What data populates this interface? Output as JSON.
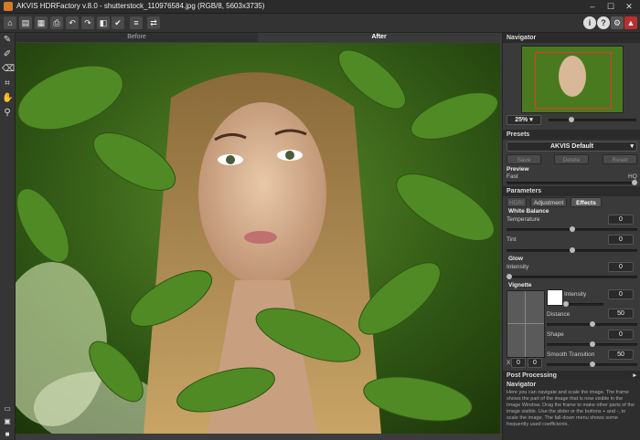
{
  "window": {
    "title": "AKVIS HDRFactory v.8.0 - shutterstock_110976584.jpg (RGB/8, 5603x3735)",
    "minimize": "–",
    "maximize": "☐",
    "close": "✕"
  },
  "toolbar": {
    "help_icon": "?",
    "info_icon": "i"
  },
  "tabs": {
    "before": "Before",
    "after": "After"
  },
  "navigator": {
    "header": "Navigator",
    "zoom": "25%"
  },
  "presets": {
    "header": "Presets",
    "selected": "AKVIS Default",
    "save": "Save",
    "delete": "Delete",
    "reset": "Reset"
  },
  "preview": {
    "label": "Preview",
    "fast": "Fast",
    "hq": "HQ",
    "level": 1.0
  },
  "parameters": {
    "header": "Parameters",
    "tabs": [
      "HDRI",
      "Adjustment",
      "Effects"
    ],
    "white_balance": {
      "label": "White Balance",
      "temperature_label": "Temperature",
      "temperature": "0",
      "tint_label": "Tint",
      "tint": "0"
    },
    "glow": {
      "label": "Glow",
      "intensity_label": "Intensity",
      "intensity": "0"
    },
    "vignette": {
      "label": "Vignette",
      "intensity_label": "Intensity",
      "intensity": "0",
      "distance_label": "Distance",
      "distance": "50",
      "shape_label": "Shape",
      "shape": "0",
      "smooth_label": "Smooth Transition",
      "smooth": "50",
      "x_label": "X",
      "x": "0",
      "y": "0",
      "color": "#ffffff"
    }
  },
  "post_processing": {
    "header": "Post Processing"
  },
  "help": {
    "title": "Navigator",
    "text": "Here you can navigate and scale the image. The frame shows the part of the image that is now visible in the Image Window. Drag the frame to make other parts of the image visible. Use the slider or the buttons + and -, to scale the image. The fall-down menu shows some frequently used coefficients."
  },
  "colors": {
    "accent": "#d77a2c",
    "panel": "#3a3a3a",
    "header": "#2b2b2b"
  }
}
